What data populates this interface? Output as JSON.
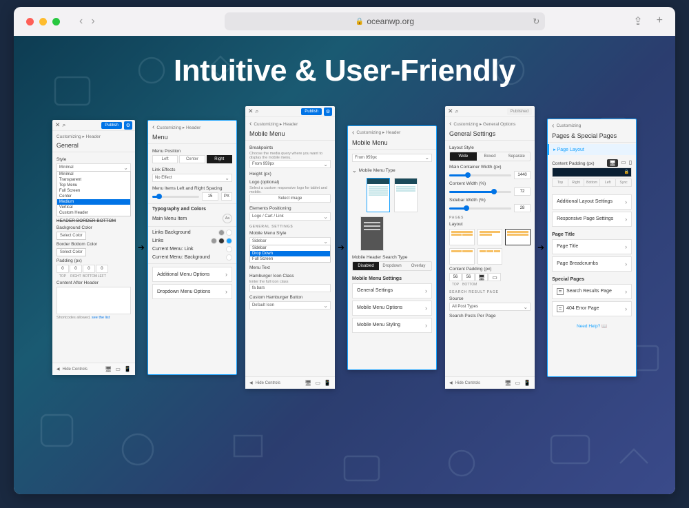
{
  "browser": {
    "url": "oceanwp.org"
  },
  "headline": "Intuitive & User-Friendly",
  "panelA": {
    "publish": "Publish",
    "crumb": "Customizing ▸ Header",
    "title": "General",
    "style_label": "Style",
    "style_value": "Minimal",
    "style_options": [
      "Minimal",
      "Transparent",
      "Top Menu",
      "Full Screen",
      "Center",
      "Medium",
      "Vertical",
      "Custom Header"
    ],
    "header_border": "HEADER BORDER BOTTOM",
    "bg_color": "Background Color",
    "select_color": "Select Color",
    "border_color": "Border Bottom Color",
    "padding": "Padding (px)",
    "pad_vals": [
      "0",
      "0",
      "0",
      "0"
    ],
    "pad_lbls": [
      "TOP",
      "RIGHT",
      "BOTTOM",
      "LEFT"
    ],
    "content_after": "Content After Header",
    "shortcodes": "Shortcodes allowed,",
    "see_list": "see the list",
    "hide_controls": "Hide Controls"
  },
  "panelB": {
    "crumb": "Customizing ▸ Header",
    "title": "Menu",
    "menu_pos": "Menu Position",
    "pos": [
      "Left",
      "Center",
      "Right"
    ],
    "link_eff": "Link Effects",
    "no_effect": "No Effect",
    "menu_spacing": "Menu Items Left and Right Spacing",
    "spacing_val": "15",
    "spacing_unit": "PX",
    "typo": "Typography and Colors",
    "main_item": "Main Menu Item",
    "links_bg": "Links Background",
    "links": "Links",
    "cur_link": "Current Menu: Link",
    "cur_bg": "Current Menu: Background",
    "add_menu": "Additional Menu Options",
    "drop_menu": "Dropdown Menu Options"
  },
  "panelC": {
    "publish": "Publish",
    "crumb": "Customizing ▸ Header",
    "title": "Mobile Menu",
    "breakpoints": "Breakpoints",
    "bp_desc": "Choose the media query where you want to display the mobile menu.",
    "bp_val": "From 959px",
    "height": "Height (px)",
    "logo": "Logo (optional)",
    "logo_desc": "Select a custom responsive logo for tablet and mobile.",
    "select_img": "Select image",
    "elem_pos": "Elements Positioning",
    "elem_val": "Logo / Cart / Link",
    "gen_settings": "GENERAL SETTINGS",
    "mm_style": "Mobile Menu Style",
    "mm_val": "Sidebar",
    "mm_options": [
      "Sidebar",
      "Drop Down",
      "Full Screen"
    ],
    "menu_text": "Menu Text",
    "hamburger": "Hamburger Icon Class",
    "hamburger_desc": "Enter the full icon class",
    "hamburger_val": "fa bars",
    "custom_ham": "Custom Hamburger Button",
    "custom_ham_val": "Default Icon",
    "hide_controls": "Hide Controls"
  },
  "panelD": {
    "crumb": "Customizing ▸ Header",
    "title": "Mobile Menu",
    "from": "From 959px",
    "mm_type": "Mobile Menu Type",
    "search": "Mobile Header Search Type",
    "search_opts": [
      "Disabled",
      "Dropdown",
      "Overlay"
    ],
    "mm_settings": "Mobile Menu Settings",
    "rows": [
      "General Settings",
      "Mobile Menu Options",
      "Mobile Menu Styling"
    ]
  },
  "panelE": {
    "published": "Published",
    "crumb": "Customizing ▸ General Options",
    "title": "General Settings",
    "layout_style": "Layout Style",
    "layout_opts": [
      "Wide",
      "Boxed",
      "Separate"
    ],
    "main_width": "Main Container Width (px)",
    "main_val": "1440",
    "content_w": "Content Width (%)",
    "content_val": "72",
    "sidebar_w": "Sidebar Width (%)",
    "sidebar_val": "28",
    "pages": "PAGES",
    "layout": "Layout",
    "cpad": "Content Padding (px)",
    "cpad_vals": [
      "56",
      "56"
    ],
    "cpad_lbls": [
      "TOP",
      "BOTTOM"
    ],
    "search_page": "SEARCH RESULT PAGE",
    "source": "Source",
    "source_val": "All Post Types",
    "search_posts": "Search Posts Per Page",
    "hide_controls": "Hide Controls"
  },
  "panelF": {
    "crumb": "Customizing",
    "title": "Pages & Special Pages",
    "page_layout": "Page Layout",
    "cpad": "Content Padding (px)",
    "tabs": [
      "Top",
      "Right",
      "Bottom",
      "Left",
      "Sync"
    ],
    "rows1": [
      "Additional Layout Settings",
      "Responsive Page Settings"
    ],
    "page_title": "Page Title",
    "rows2": [
      "Page Title",
      "Page Breadcrumbs"
    ],
    "special": "Special Pages",
    "rows3": [
      "Search Results Page",
      "404 Error Page"
    ],
    "help": "Need Help?"
  }
}
